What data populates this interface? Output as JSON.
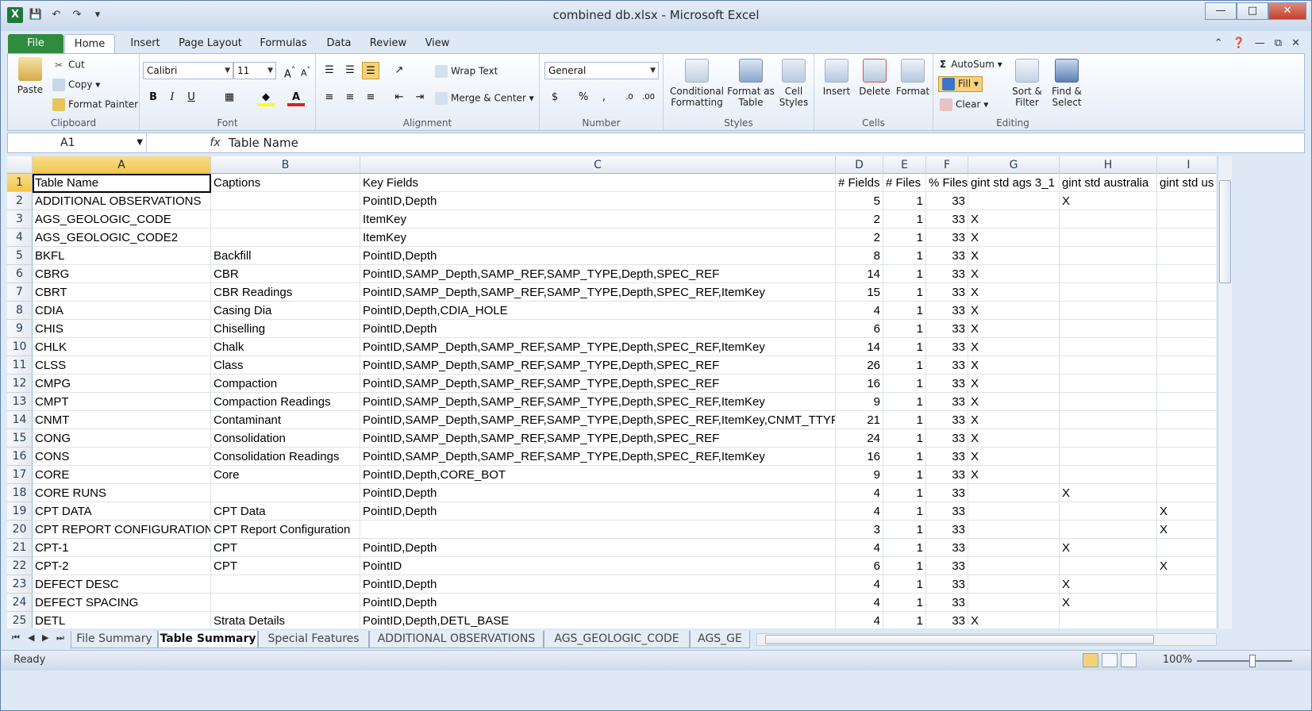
{
  "window": {
    "title": "combined db.xlsx - Microsoft Excel"
  },
  "colors": {
    "file_tab": "#2f8b3e",
    "selection": "#f2c44b"
  },
  "ribbon_tabs": [
    "File",
    "Home",
    "Insert",
    "Page Layout",
    "Formulas",
    "Data",
    "Review",
    "View"
  ],
  "clipboard": {
    "paste": "Paste",
    "cut": "Cut",
    "copy": "Copy",
    "format_painter": "Format Painter",
    "label": "Clipboard"
  },
  "font": {
    "name": "Calibri",
    "size": "11",
    "label": "Font"
  },
  "alignment": {
    "wrap": "Wrap Text",
    "merge": "Merge & Center",
    "label": "Alignment"
  },
  "number": {
    "format": "General",
    "label": "Number"
  },
  "styles": {
    "conditional": "Conditional",
    "conditional2": "Formatting",
    "format_as": "Format as",
    "format_as2": "Table",
    "cell": "Cell",
    "cell2": "Styles",
    "label": "Styles"
  },
  "cells": {
    "insert": "Insert",
    "delete": "Delete",
    "format": "Format",
    "label": "Cells"
  },
  "editing": {
    "autosum": "AutoSum",
    "fill": "Fill",
    "clear": "Clear",
    "sort": "Sort &",
    "sort2": "Filter",
    "find": "Find &",
    "find2": "Select",
    "label": "Editing"
  },
  "formula_bar": {
    "name_box": "A1",
    "content": "Table Name",
    "fx": "fx"
  },
  "columns": [
    "A",
    "B",
    "C",
    "D",
    "E",
    "F",
    "G",
    "H",
    "I"
  ],
  "rows": [
    [
      "Table Name",
      "Captions",
      "Key Fields",
      "# Fields",
      "# Files",
      "% Files",
      "gint std ags 3_1",
      "gint std australia",
      "gint std us"
    ],
    [
      "ADDITIONAL OBSERVATIONS",
      "",
      "PointID,Depth",
      "5",
      "1",
      "33",
      "",
      "X",
      ""
    ],
    [
      "AGS_GEOLOGIC_CODE",
      "",
      "ItemKey",
      "2",
      "1",
      "33",
      "X",
      "",
      ""
    ],
    [
      "AGS_GEOLOGIC_CODE2",
      "",
      "ItemKey",
      "2",
      "1",
      "33",
      "X",
      "",
      ""
    ],
    [
      "BKFL",
      "Backfill",
      "PointID,Depth",
      "8",
      "1",
      "33",
      "X",
      "",
      ""
    ],
    [
      "CBRG",
      "CBR",
      "PointID,SAMP_Depth,SAMP_REF,SAMP_TYPE,Depth,SPEC_REF",
      "14",
      "1",
      "33",
      "X",
      "",
      ""
    ],
    [
      "CBRT",
      "CBR Readings",
      "PointID,SAMP_Depth,SAMP_REF,SAMP_TYPE,Depth,SPEC_REF,ItemKey",
      "15",
      "1",
      "33",
      "X",
      "",
      ""
    ],
    [
      "CDIA",
      "Casing Dia",
      "PointID,Depth,CDIA_HOLE",
      "4",
      "1",
      "33",
      "X",
      "",
      ""
    ],
    [
      "CHIS",
      "Chiselling",
      "PointID,Depth",
      "6",
      "1",
      "33",
      "X",
      "",
      ""
    ],
    [
      "CHLK",
      "Chalk",
      "PointID,SAMP_Depth,SAMP_REF,SAMP_TYPE,Depth,SPEC_REF,ItemKey",
      "14",
      "1",
      "33",
      "X",
      "",
      ""
    ],
    [
      "CLSS",
      "Class",
      "PointID,SAMP_Depth,SAMP_REF,SAMP_TYPE,Depth,SPEC_REF",
      "26",
      "1",
      "33",
      "X",
      "",
      ""
    ],
    [
      "CMPG",
      "Compaction",
      "PointID,SAMP_Depth,SAMP_REF,SAMP_TYPE,Depth,SPEC_REF",
      "16",
      "1",
      "33",
      "X",
      "",
      ""
    ],
    [
      "CMPT",
      "Compaction Readings",
      "PointID,SAMP_Depth,SAMP_REF,SAMP_TYPE,Depth,SPEC_REF,ItemKey",
      "9",
      "1",
      "33",
      "X",
      "",
      ""
    ],
    [
      "CNMT",
      "Contaminant",
      "PointID,SAMP_Depth,SAMP_REF,SAMP_TYPE,Depth,SPEC_REF,ItemKey,CNMT_TTYP",
      "21",
      "1",
      "33",
      "X",
      "",
      ""
    ],
    [
      "CONG",
      "Consolidation",
      "PointID,SAMP_Depth,SAMP_REF,SAMP_TYPE,Depth,SPEC_REF",
      "24",
      "1",
      "33",
      "X",
      "",
      ""
    ],
    [
      "CONS",
      "Consolidation Readings",
      "PointID,SAMP_Depth,SAMP_REF,SAMP_TYPE,Depth,SPEC_REF,ItemKey",
      "16",
      "1",
      "33",
      "X",
      "",
      ""
    ],
    [
      "CORE",
      "Core",
      "PointID,Depth,CORE_BOT",
      "9",
      "1",
      "33",
      "X",
      "",
      ""
    ],
    [
      "CORE RUNS",
      "",
      "PointID,Depth",
      "4",
      "1",
      "33",
      "",
      "X",
      ""
    ],
    [
      "CPT DATA",
      "CPT Data",
      "PointID,Depth",
      "4",
      "1",
      "33",
      "",
      "",
      "X"
    ],
    [
      "CPT REPORT CONFIGURATION",
      "CPT Report Configuration",
      "",
      "3",
      "1",
      "33",
      "",
      "",
      "X"
    ],
    [
      "CPT-1",
      "CPT",
      "PointID,Depth",
      "4",
      "1",
      "33",
      "",
      "X",
      ""
    ],
    [
      "CPT-2",
      "CPT",
      "PointID",
      "6",
      "1",
      "33",
      "",
      "",
      "X"
    ],
    [
      "DEFECT DESC",
      "",
      "PointID,Depth",
      "4",
      "1",
      "33",
      "",
      "X",
      ""
    ],
    [
      "DEFECT SPACING",
      "",
      "PointID,Depth",
      "4",
      "1",
      "33",
      "",
      "X",
      ""
    ],
    [
      "DETL",
      "Strata Details",
      "PointID,Depth,DETL_BASE",
      "4",
      "1",
      "33",
      "X",
      "",
      ""
    ]
  ],
  "sheet_tabs": [
    "File Summary",
    "Table Summary",
    "Special Features",
    "ADDITIONAL OBSERVATIONS",
    "AGS_GEOLOGIC_CODE",
    "AGS_GE"
  ],
  "status": {
    "ready": "Ready",
    "zoom": "100%"
  }
}
